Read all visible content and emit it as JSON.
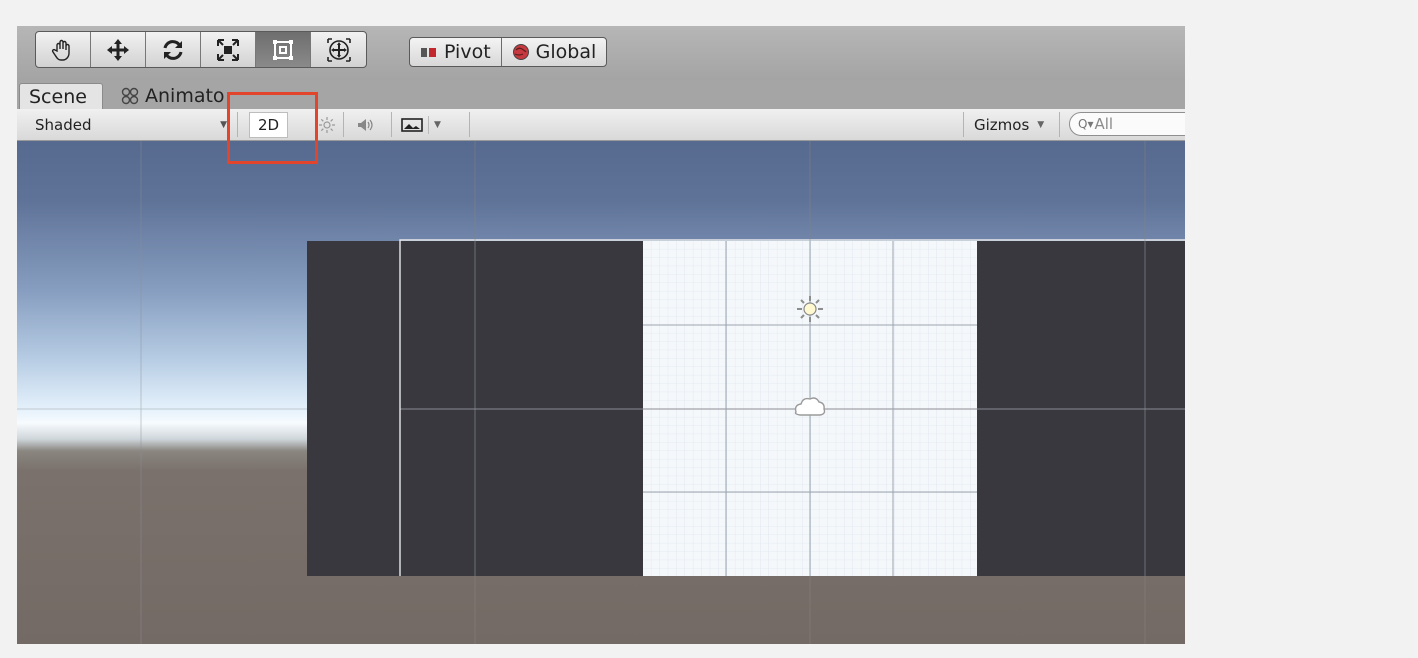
{
  "tabs": [
    {
      "label": "Scene",
      "active": true
    },
    {
      "label": "Animato",
      "icon": "animator-icon"
    }
  ],
  "tools": [
    {
      "name": "hand-tool",
      "icon": "hand-icon"
    },
    {
      "name": "move-tool",
      "icon": "move-arrows-icon"
    },
    {
      "name": "rotate-tool",
      "icon": "rotate-icon"
    },
    {
      "name": "scale-tool",
      "icon": "scale-icon"
    },
    {
      "name": "rect-tool",
      "icon": "rect-icon",
      "active": true
    },
    {
      "name": "transform-tool",
      "icon": "transform-icon"
    }
  ],
  "pivot": {
    "pivot_label": "Pivot",
    "global_label": "Global"
  },
  "scene_toolbar": {
    "shading_mode": "Shaded",
    "mode_2d": "2D",
    "gizmos_label": "Gizmos",
    "search_placeholder": "All"
  },
  "colors": {
    "highlight": "#e2452b",
    "canvas_white": "#f5f8fb",
    "dark_panel": "#38383e"
  }
}
